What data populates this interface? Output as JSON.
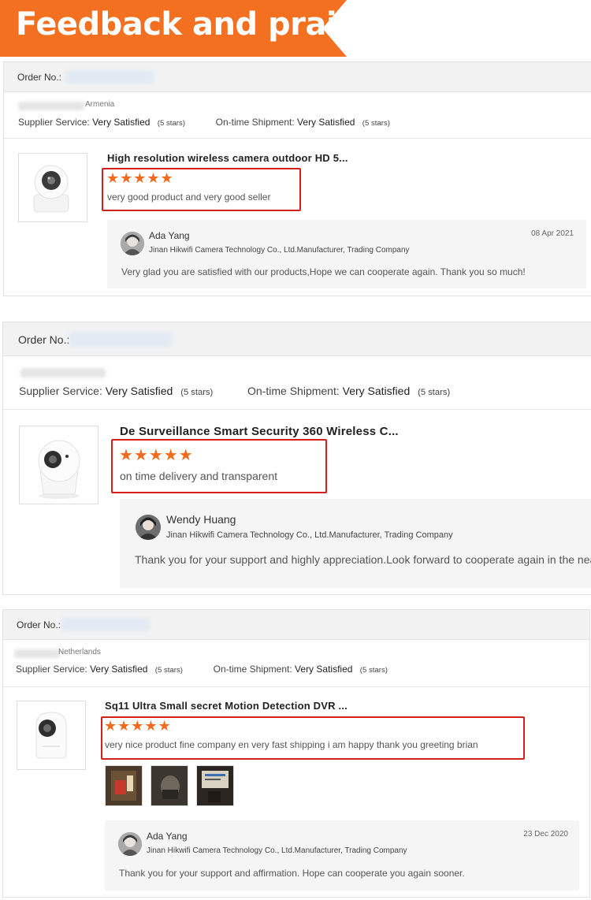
{
  "banner": {
    "title": "Feedback and praise"
  },
  "reviews": [
    {
      "order_label": "Order No.:",
      "country": "Armenia",
      "supplier_service_label": "Supplier Service:",
      "supplier_service_value": "Very Satisfied",
      "supplier_service_stars": "(5 stars)",
      "shipment_label": "On-time Shipment:",
      "shipment_value": "Very Satisfied",
      "shipment_stars": "(5 stars)",
      "product_title": "High resolution wireless camera outdoor HD 5...",
      "rating": 5,
      "stars_text": "★★★★★",
      "review_text": "very good product and very good seller",
      "reply": {
        "name": "Ada Yang",
        "company": "Jinan Hikwifi Camera Technology Co., Ltd.Manufacturer, Trading Company",
        "date": "08 Apr 2021",
        "text": "Very glad you are satisfied with our products,Hope we can cooperate again. Thank you so much!"
      }
    },
    {
      "order_label": "Order No.:",
      "country": "",
      "supplier_service_label": "Supplier Service:",
      "supplier_service_value": "Very Satisfied",
      "supplier_service_stars": "(5 stars)",
      "shipment_label": "On-time Shipment:",
      "shipment_value": "Very Satisfied",
      "shipment_stars": "(5 stars)",
      "product_title": "De Surveillance Smart Security 360 Wireless C...",
      "rating": 5,
      "stars_text": "★★★★★",
      "review_text": "on time delivery and transparent",
      "reply": {
        "name": "Wendy Huang",
        "company": "Jinan Hikwifi Camera Technology Co., Ltd.Manufacturer, Trading Company",
        "date": "",
        "text": "Thank you for your support and highly appreciation.Look forward to cooperate again in the near"
      }
    },
    {
      "order_label": "Order No.:",
      "country": "Netherlands",
      "supplier_service_label": "Supplier Service:",
      "supplier_service_value": "Very Satisfied",
      "supplier_service_stars": "(5 stars)",
      "shipment_label": "On-time Shipment:",
      "shipment_value": "Very Satisfied",
      "shipment_stars": "(5 stars)",
      "product_title": "Sq11 Ultra Small secret Motion Detection DVR ...",
      "rating": 5,
      "stars_text": "★★★★★",
      "review_text": "very nice product fine company en very fast shipping i am happy thank you greeting brian",
      "reply": {
        "name": "Ada Yang",
        "company": "Jinan Hikwifi Camera Technology Co., Ltd.Manufacturer, Trading Company",
        "date": "23 Dec 2020",
        "text": "Thank you for your support and affirmation. Hope can cooperate you again sooner."
      }
    }
  ],
  "colors": {
    "accent": "#f37021",
    "star": "#f26b1d",
    "highlight_border": "#d4201c"
  },
  "icons": {
    "star": "star-icon",
    "camera_thumb": "camera-product-image",
    "avatar": "avatar"
  }
}
